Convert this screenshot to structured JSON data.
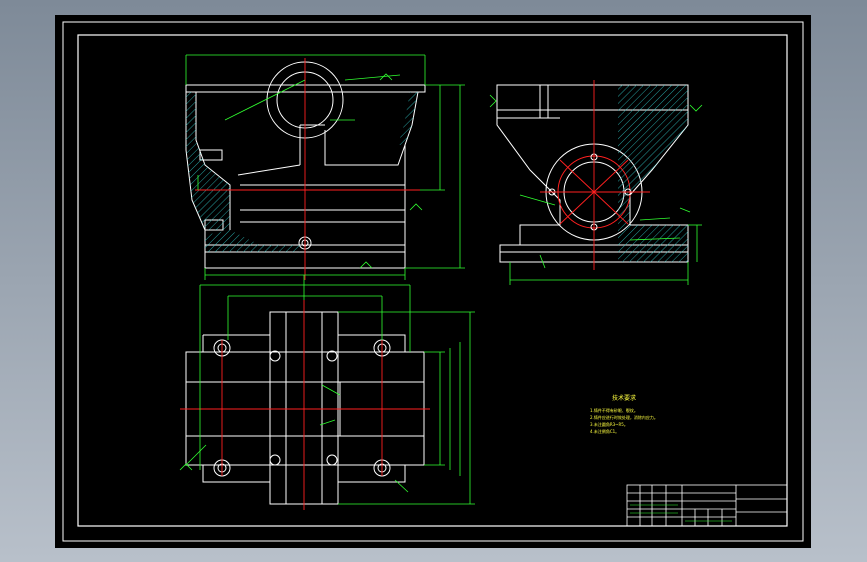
{
  "drawing": {
    "notes": {
      "title": "技术要求",
      "lines": [
        "1.铸件不得有砂眼、裂纹。",
        "2.铸件应进行时效处理，消除内应力。",
        "3.未注圆角R3~R5。",
        "4.未注倒角C1。"
      ]
    },
    "title_block": {
      "rows": 5,
      "cols": 8
    },
    "colors": {
      "background": "#000000",
      "frame": "#ffffff",
      "outline": "#ffffff",
      "centerline": "#ff2020",
      "dimension": "#30ff30",
      "hatch": "#30c8c8",
      "text": "#ffff40"
    }
  }
}
